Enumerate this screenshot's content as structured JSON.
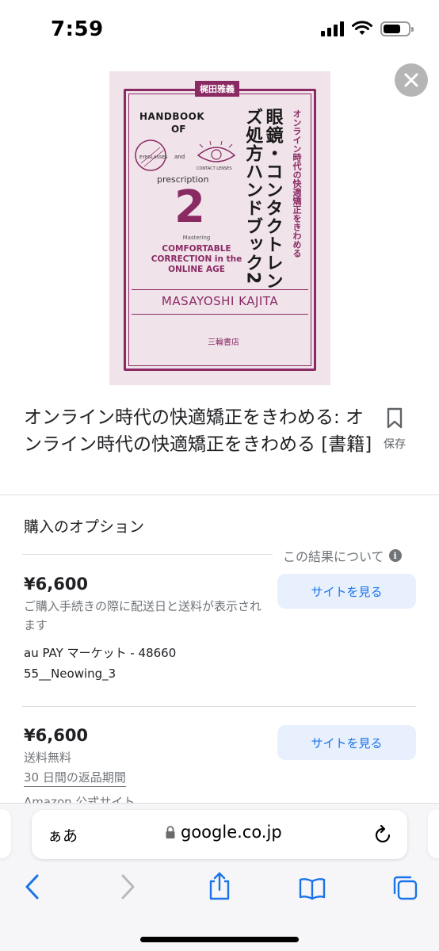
{
  "status_bar": {
    "time": "7:59",
    "icons": [
      "signal-icon",
      "wifi-icon",
      "battery-icon"
    ]
  },
  "book_cover": {
    "author_tag": "梶田雅義",
    "en_title_1": "HANDBOOK",
    "en_title_2": "OF",
    "lens_left": "EYEGLASSES",
    "lens_and": "and",
    "lens_right": "CONTACT LENSES",
    "prescription": "prescription",
    "number": "2",
    "mastering": "Mastering",
    "en_sub": "COMFORTABLE CORRECTION in the ONLINE AGE",
    "author_en": "MASAYOSHI KAJITA",
    "publisher": "三輪書店",
    "jp_title": "眼鏡・コンタクトレンズ処方ハンドブック2",
    "jp_subtitle": "オンライン時代の快適矯正をきわめる"
  },
  "product": {
    "title": "オンライン時代の快適矯正をきわめる: オンライン時代の快適矯正をきわめる [書籍]",
    "save_label": "保存"
  },
  "purchase": {
    "heading": "購入のオプション",
    "about": "この結果について",
    "offers": [
      {
        "price": "¥6,600",
        "note": "ご購入手続きの際に配送日と送料が表示されます",
        "seller": "au PAY マーケット - 4866055__Neowing_3",
        "button": "サイトを見る"
      },
      {
        "price": "¥6,600",
        "note": "送料無料",
        "returns": "30 日間の返品期間",
        "seller": "Amazon 公式サイト",
        "button": "サイトを見る"
      }
    ]
  },
  "browser": {
    "aa": "ぁあ",
    "url": "google.co.jp"
  },
  "colors": {
    "accent": "#1a73e8",
    "button_bg": "#e8f0fe",
    "book_accent": "#8a2a63",
    "book_bg": "#f0e3ea"
  }
}
